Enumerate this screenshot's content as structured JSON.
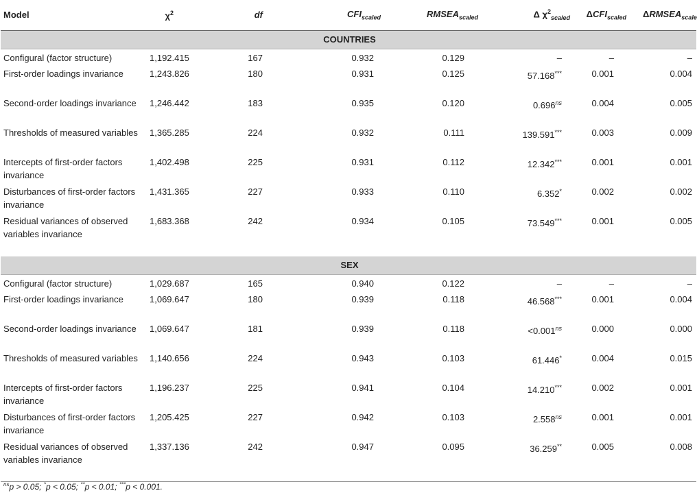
{
  "headers": {
    "model": "Model",
    "chi_symbol": "χ",
    "chi_sup": "2",
    "df": "df",
    "cfi_main": "CFI",
    "cfi_sub": "scaled",
    "rmsea_main": "RMSEA",
    "rmsea_sub": "scaled",
    "dchi_prefix": "Δ χ",
    "dchi_sup": "2",
    "dchi_sub": "scaled",
    "dcfi_prefix": "Δ",
    "dcfi_main": "CFI",
    "dcfi_sub": "scaled",
    "drmsea_prefix": "Δ",
    "drmsea_main": "RMSEA",
    "drmsea_sub": "scaled"
  },
  "sections": [
    {
      "title": "COUNTRIES",
      "rows": [
        {
          "model": "Configural (factor structure)",
          "chi2": "1,192.415",
          "df": "167",
          "cfi": "0.932",
          "rmsea": "0.129",
          "dchi": "–",
          "dchi_sig": "",
          "dcfi": "–",
          "drmsea": "–"
        },
        {
          "model": "First-order loadings invariance",
          "chi2": "1,243.826",
          "df": "180",
          "cfi": "0.931",
          "rmsea": "0.125",
          "dchi": "57.168",
          "dchi_sig": "***",
          "dcfi": "0.001",
          "drmsea": "0.004"
        },
        {
          "model": "Second-order loadings invariance",
          "chi2": "1,246.442",
          "df": "183",
          "cfi": "0.935",
          "rmsea": "0.120",
          "dchi": "0.696",
          "dchi_sig": "ns",
          "dcfi": "0.004",
          "drmsea": "0.005"
        },
        {
          "model": "Thresholds of measured variables",
          "chi2": "1,365.285",
          "df": "224",
          "cfi": "0.932",
          "rmsea": "0.111",
          "dchi": "139.591",
          "dchi_sig": "***",
          "dcfi": "0.003",
          "drmsea": "0.009"
        },
        {
          "model": "Intercepts of first-order factors invariance",
          "chi2": "1,402.498",
          "df": "225",
          "cfi": "0.931",
          "rmsea": "0.112",
          "dchi": "12.342",
          "dchi_sig": "***",
          "dcfi": "0.001",
          "drmsea": "0.001"
        },
        {
          "model": "Disturbances of first-order factors invariance",
          "chi2": "1,431.365",
          "df": "227",
          "cfi": "0.933",
          "rmsea": "0.110",
          "dchi": "6.352",
          "dchi_sig": "*",
          "dcfi": "0.002",
          "drmsea": "0.002"
        },
        {
          "model": "Residual variances of observed variables invariance",
          "chi2": "1,683.368",
          "df": "242",
          "cfi": "0.934",
          "rmsea": "0.105",
          "dchi": "73.549",
          "dchi_sig": "***",
          "dcfi": "0.001",
          "drmsea": "0.005"
        }
      ]
    },
    {
      "title": "SEX",
      "rows": [
        {
          "model": "Configural (factor structure)",
          "chi2": "1,029.687",
          "df": "165",
          "cfi": "0.940",
          "rmsea": "0.122",
          "dchi": "–",
          "dchi_sig": "",
          "dcfi": "–",
          "drmsea": "–"
        },
        {
          "model": "First-order loadings invariance",
          "chi2": "1,069.647",
          "df": "180",
          "cfi": "0.939",
          "rmsea": "0.118",
          "dchi": "46.568",
          "dchi_sig": "***",
          "dcfi": "0.001",
          "drmsea": "0.004"
        },
        {
          "model": "Second-order loadings invariance",
          "chi2": "1,069.647",
          "df": "181",
          "cfi": "0.939",
          "rmsea": "0.118",
          "dchi": "<0.001",
          "dchi_sig": "ns",
          "dcfi": "0.000",
          "drmsea": "0.000"
        },
        {
          "model": "Thresholds of measured variables",
          "chi2": "1,140.656",
          "df": "224",
          "cfi": "0.943",
          "rmsea": "0.103",
          "dchi": "61.446",
          "dchi_sig": "*",
          "dcfi": "0.004",
          "drmsea": "0.015"
        },
        {
          "model": "Intercepts of first-order factors invariance",
          "chi2": "1,196.237",
          "df": "225",
          "cfi": "0.941",
          "rmsea": "0.104",
          "dchi": "14.210",
          "dchi_sig": "***",
          "dcfi": "0.002",
          "drmsea": "0.001"
        },
        {
          "model": "Disturbances of first-order factors invariance",
          "chi2": "1,205.425",
          "df": "227",
          "cfi": "0.942",
          "rmsea": "0.103",
          "dchi": "2.558",
          "dchi_sig": "ns",
          "dcfi": "0.001",
          "drmsea": "0.001"
        },
        {
          "model": "Residual variances of observed variables invariance",
          "chi2": "1,337.136",
          "df": "242",
          "cfi": "0.947",
          "rmsea": "0.095",
          "dchi": "36.259",
          "dchi_sig": "**",
          "dcfi": "0.005",
          "drmsea": "0.008"
        }
      ]
    }
  ],
  "footnote": {
    "ns_sup": "ns",
    "text1": "p > 0.05; ",
    "s1_sup": "*",
    "text2": "p < 0.05; ",
    "s2_sup": "**",
    "text3": "p < 0.01; ",
    "s3_sup": "***",
    "text4": "p < 0.001."
  }
}
